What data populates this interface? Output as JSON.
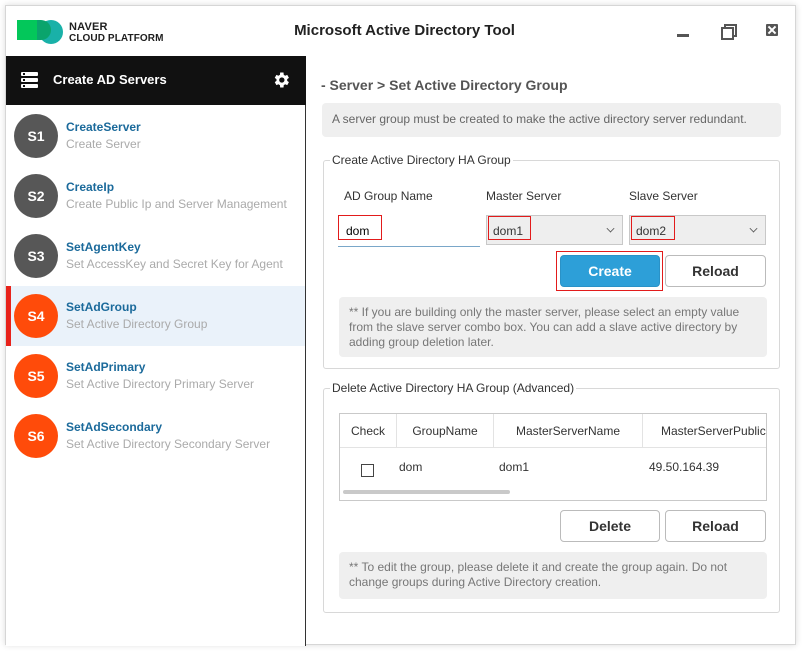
{
  "window": {
    "title": "Microsoft Active Directory Tool",
    "logo_line1": "NAVER",
    "logo_line2": "CLOUD PLATFORM"
  },
  "sidebar": {
    "header_title": "Create AD Servers",
    "steps": [
      {
        "badge": "S1",
        "name": "CreateServer",
        "desc": "Create Server",
        "state": "done"
      },
      {
        "badge": "S2",
        "name": "CreateIp",
        "desc": "Create Public Ip and Server Management",
        "state": "done"
      },
      {
        "badge": "S3",
        "name": "SetAgentKey",
        "desc": "Set AccessKey and Secret Key for Agent",
        "state": "done"
      },
      {
        "badge": "S4",
        "name": "SetAdGroup",
        "desc": "Set Active Directory Group",
        "state": "active"
      },
      {
        "badge": "S5",
        "name": "SetAdPrimary",
        "desc": "Set Active Directory Primary Server",
        "state": "todo"
      },
      {
        "badge": "S6",
        "name": "SetAdSecondary",
        "desc": "Set Active Directory Secondary Server",
        "state": "todo"
      }
    ]
  },
  "main": {
    "breadcrumb": "- Server > Set Active Directory Group",
    "info": "A server group must be created to make the active directory server redundant.",
    "create_group": {
      "legend": "Create Active Directory HA Group",
      "group_name_label": "AD Group Name",
      "group_name_value": "dom",
      "master_label": "Master Server",
      "master_value": "dom1",
      "slave_label": "Slave Server",
      "slave_value": "dom2",
      "create_button": "Create",
      "reload_button": "Reload",
      "note": "** If you are building only the master server, please select an empty value from the slave server combo box. You can add a slave active directory by adding group deletion later."
    },
    "delete_group": {
      "legend": "Delete Active Directory HA Group (Advanced)",
      "columns": [
        "Check",
        "GroupName",
        "MasterServerName",
        "MasterServerPublic"
      ],
      "rows": [
        {
          "checked": false,
          "group": "dom",
          "master": "dom1",
          "ip": "49.50.164.39"
        }
      ],
      "delete_button": "Delete",
      "reload_button": "Reload",
      "note": "** To edit the group, please delete it and create the group again. Do not change groups during Active Directory creation."
    }
  },
  "colors": {
    "accent_blue": "#2d9fd8",
    "step_done": "#575757",
    "step_todo": "#ff4b0a",
    "active_marker": "#e8231b",
    "highlight_box": "#e21b1b"
  }
}
